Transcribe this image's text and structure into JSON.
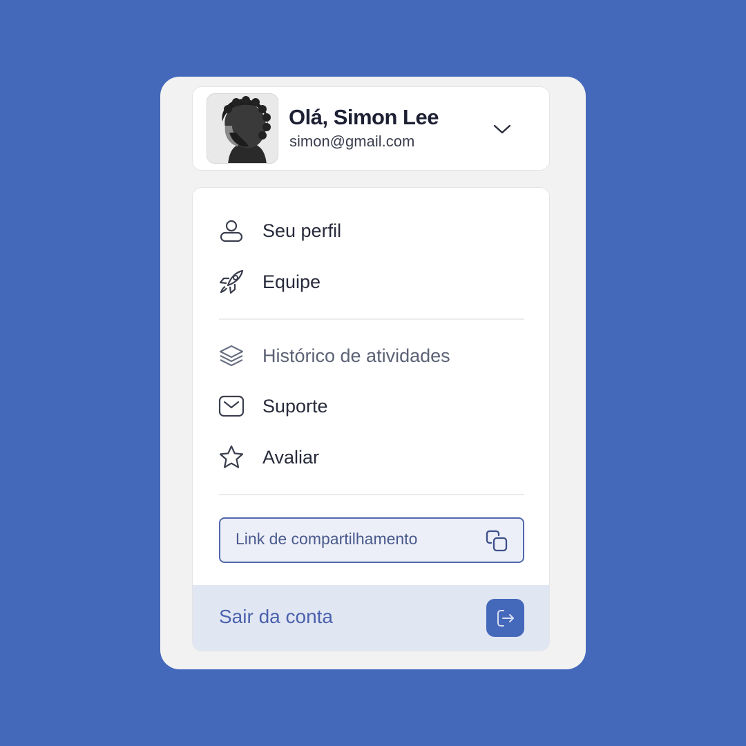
{
  "user": {
    "greeting": "Olá, Simon Lee",
    "email": "simon@gmail.com",
    "avatar_icon": "avatar-photo",
    "dropdown_icon": "chevron-down-icon"
  },
  "menu": {
    "group1": [
      {
        "label": "Seu perfil",
        "icon": "user-icon"
      },
      {
        "label": "Equipe",
        "icon": "rocket-icon"
      }
    ],
    "group2": [
      {
        "label": "Histórico de atividades",
        "icon": "layers-icon"
      },
      {
        "label": "Suporte",
        "icon": "mail-icon"
      },
      {
        "label": "Avaliar",
        "icon": "star-icon"
      }
    ]
  },
  "share": {
    "label": "Link de compartilhamento",
    "icon": "copy-icon"
  },
  "logout": {
    "label": "Sair da conta",
    "icon": "logout-icon"
  },
  "colors": {
    "background": "#4468BA",
    "accent": "#4A62AD",
    "logout_bg": "#E1E6F3"
  }
}
